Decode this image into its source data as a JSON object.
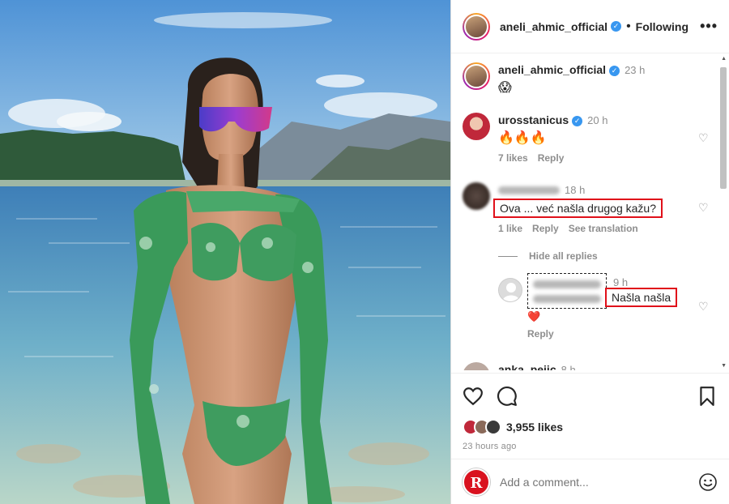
{
  "post": {
    "author": "aneli_ahmic_official",
    "follow_status": "Following",
    "more_icon": "more-horizontal-icon"
  },
  "caption": {
    "username": "aneli_ahmic_official",
    "time": "23 h",
    "emoji": "😱"
  },
  "comments": [
    {
      "username": "urosstanicus",
      "time": "20 h",
      "text": "🔥🔥🔥",
      "likes": "7 likes",
      "reply": "Reply"
    },
    {
      "time": "18 h",
      "text": "Ova ... već našla drugog kažu?",
      "likes": "1 like",
      "reply": "Reply",
      "translation": "See translation"
    }
  ],
  "hide_replies": "Hide all replies",
  "reply_comment": {
    "time": "9 h",
    "text": "Našla našla",
    "emoji": "❤️",
    "reply": "Reply"
  },
  "partial_comment": {
    "username": "anka_pejic",
    "time": "8 h"
  },
  "actions": {
    "likes": "3,955 likes",
    "posted_ago": "23 hours ago"
  },
  "add_comment": {
    "placeholder": "Add a comment...",
    "logo_letter": "R"
  },
  "colors": {
    "verified": "#3897f0",
    "highlight": "#e0101a",
    "muted": "#8e8e8e"
  }
}
